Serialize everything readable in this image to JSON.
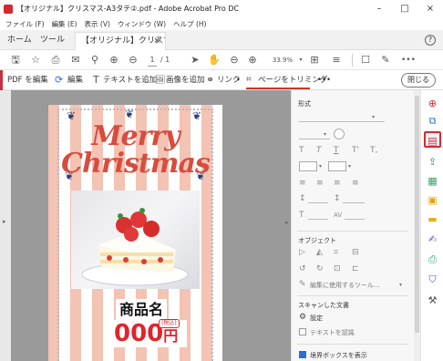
{
  "titlebar": {
    "title": "【オリジナル】クリスマス-A3タテ②.pdf - Adobe Acrobat Pro DC",
    "minimize": "–",
    "maximize": "□",
    "close": "×"
  },
  "menubar": {
    "items": [
      "ファイル (F)",
      "編集 (E)",
      "表示 (V)",
      "ウィンドウ (W)",
      "ヘルプ (H)"
    ]
  },
  "tabs": {
    "home": "ホーム",
    "tools": "ツール",
    "doc_tab": "【オリジナル】クリスマ...",
    "doc_close": "×",
    "help": "?"
  },
  "toolbar": {
    "page_current": "1",
    "page_total": "/ 1",
    "zoom": "33.9%"
  },
  "edit_toolbar": {
    "pdf_edit": "PDF を編集",
    "edit": "編集",
    "add_text": "テキストを追加",
    "add_image": "画像を追加",
    "link": "リンク",
    "crop": "ページをトリミング",
    "more": "•••",
    "close": "閉じる"
  },
  "poster": {
    "merry": "Merry",
    "christmas": "Christmas",
    "product": "商品名",
    "price": "000",
    "yen": "円",
    "tax": "(税込)"
  },
  "right_panel": {
    "format_title": "形式",
    "object_title": "オブジェクト",
    "edit_using": "編集に使用するツール...",
    "scanned_title": "スキャンした文書",
    "settings": "設定",
    "recognize_text": "テキストを認識",
    "show_bbox": "境界ボックスを表示"
  },
  "colors": {
    "accent_red": "#d9282f",
    "acrobat_red": "#c5313f",
    "link_blue": "#2a76d2",
    "poster_red": "#d84c3e",
    "stripe": "#f3c3b4"
  }
}
